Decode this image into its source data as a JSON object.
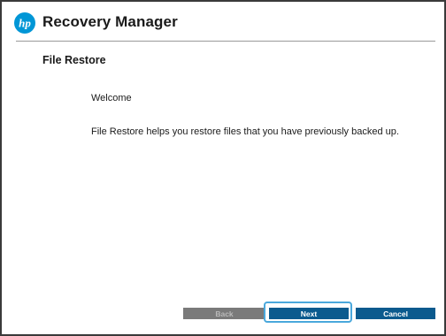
{
  "header": {
    "app_title": "Recovery Manager",
    "logo_icon": "hp-logo-icon",
    "logo_text": "hp"
  },
  "page": {
    "title": "File Restore",
    "welcome": "Welcome",
    "description": "File Restore helps you restore files that you have previously backed up."
  },
  "buttons": {
    "back_label": "Back",
    "next_label": "Next",
    "cancel_label": "Cancel"
  },
  "colors": {
    "brand_blue": "#0096d6",
    "button_blue": "#0b5a8e",
    "button_disabled": "#7a7a7a",
    "highlight": "#4aa8dc"
  }
}
